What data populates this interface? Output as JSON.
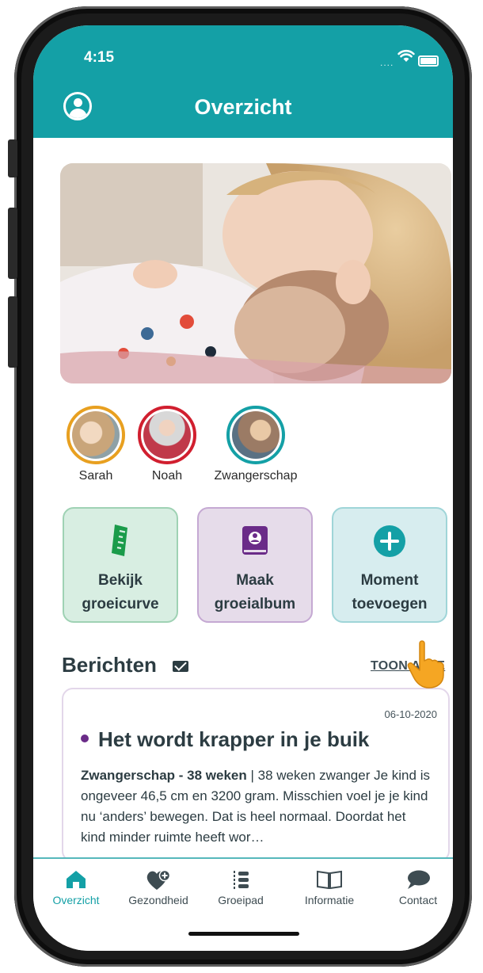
{
  "status_bar": {
    "time": "4:15",
    "signal": "...."
  },
  "header": {
    "title": "Overzicht"
  },
  "children": [
    {
      "name": "Sarah",
      "ring_color": "#e8a020",
      "fill": "#c9a57a"
    },
    {
      "name": "Noah",
      "ring_color": "#d11f2f",
      "fill": "#8c6e6a"
    },
    {
      "name": "Zwangerschap",
      "ring_color": "#14a0a6",
      "fill": "#b99a86"
    }
  ],
  "actions": [
    {
      "line1": "Bekijk",
      "line2": "groeicurve",
      "icon": "growth-ruler-icon",
      "bg": "#d8eee2",
      "border": "#9fd2b4",
      "icon_color": "#1a9b4a"
    },
    {
      "line1": "Maak",
      "line2": "groeialbum",
      "icon": "album-icon",
      "bg": "#e6dcea",
      "border": "#c5a9d3",
      "icon_color": "#6a2b88"
    },
    {
      "line1": "Moment",
      "line2": "toevoegen",
      "icon": "plus-circle-icon",
      "bg": "#d7edef",
      "border": "#9fd5d8",
      "icon_color": "#14a0a6"
    }
  ],
  "messages": {
    "heading": "Berichten",
    "show_all": "TOON ALLE",
    "items": [
      {
        "date": "06-10-2020",
        "title": "Het wordt krapper in je buik",
        "category": "Zwangerschap - 38 weken",
        "separator": " | ",
        "body": "38 weken zwanger Je kind is ongeveer 46,5 cm en 3200 gram. Misschien voel je je kind nu ‘anders’ bewegen. Dat is heel normaal. Doordat het kind minder ruimte heeft wor…"
      }
    ]
  },
  "tabs": [
    {
      "label": "Overzicht",
      "icon": "home-icon",
      "active": true
    },
    {
      "label": "Gezondheid",
      "icon": "heart-plus-icon",
      "active": false
    },
    {
      "label": "Groeipad",
      "icon": "path-icon",
      "active": false
    },
    {
      "label": "Informatie",
      "icon": "book-icon",
      "active": false
    },
    {
      "label": "Contact",
      "icon": "chat-icon",
      "active": false
    }
  ],
  "colors": {
    "primary": "#14a0a6",
    "text": "#2c3c42",
    "accent_purple": "#6a2b88"
  }
}
